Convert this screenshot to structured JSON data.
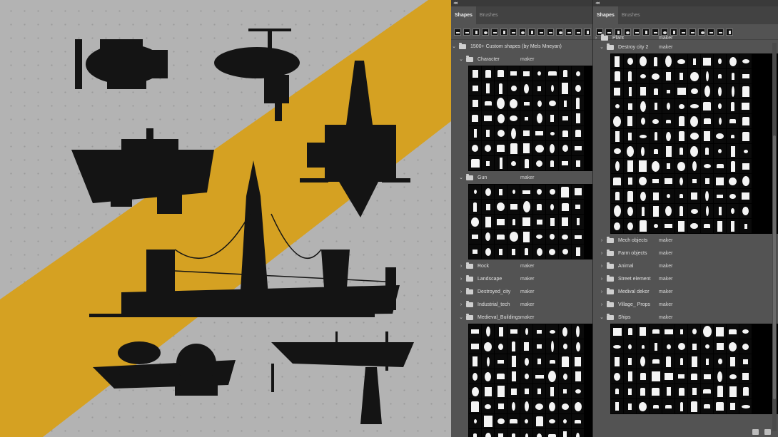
{
  "panels": {
    "left": {
      "collapse_glyph": "◂◂",
      "tabs": [
        {
          "label": "Shapes",
          "active": true
        },
        {
          "label": "Brushes",
          "active": false
        }
      ],
      "root": {
        "name": "1500+ Custom shapes (by Mels Mneyan)",
        "maker": ""
      },
      "groups_top": [
        {
          "name": "Character",
          "maker": "maker",
          "expanded": true,
          "rows": 7
        },
        {
          "name": "Gun",
          "maker": "maker",
          "expanded": true,
          "rows": 5
        }
      ],
      "collapsed": [
        {
          "name": "Rock",
          "maker": "maker"
        },
        {
          "name": "Landscape",
          "maker": "maker"
        },
        {
          "name": "Destroyed_city",
          "maker": "maker"
        },
        {
          "name": "Industrial_tech",
          "maker": "maker"
        }
      ],
      "groups_bottom": [
        {
          "name": "Medieval_Buildings",
          "maker": "maker",
          "expanded": true,
          "rows": 8
        }
      ]
    },
    "right": {
      "collapse_glyph": "◂◂",
      "tabs": [
        {
          "label": "Shapes",
          "active": true
        },
        {
          "label": "Brushes",
          "active": false
        }
      ],
      "partial_row": {
        "name": "Plant",
        "maker": "maker"
      },
      "expanded": {
        "name": "Destroy city 2",
        "maker": "maker",
        "rows": 12
      },
      "collapsed": [
        {
          "name": "Mech objects",
          "maker": "maker"
        },
        {
          "name": "Farm objects",
          "maker": "maker"
        },
        {
          "name": "Animal",
          "maker": "maker"
        },
        {
          "name": "Street element",
          "maker": "maker"
        },
        {
          "name": "Medival dekor",
          "maker": "maker"
        },
        {
          "name": "Village_ Props",
          "maker": "maker"
        }
      ],
      "ships": {
        "name": "Ships",
        "maker": "maker",
        "rows": 6
      }
    }
  },
  "icons": {
    "chevron_right": "›",
    "chevron_down": "⌄"
  },
  "colors": {
    "stripe": "#d5a122",
    "silhouette": "#141414",
    "panel": "#535353"
  }
}
